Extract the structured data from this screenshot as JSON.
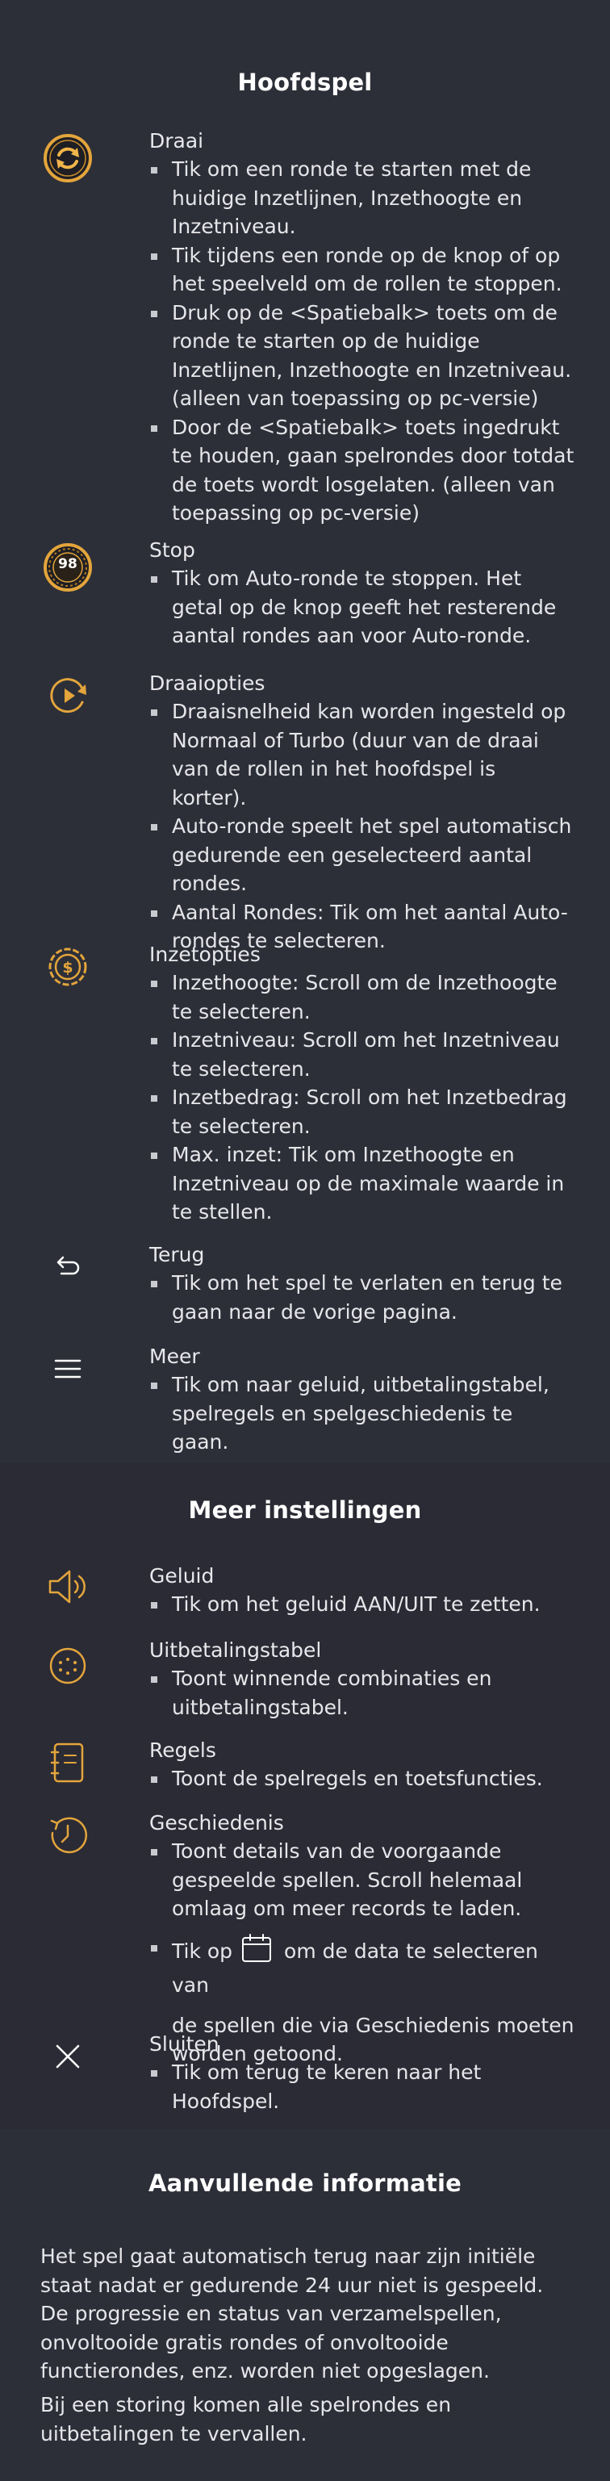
{
  "sections": {
    "main_game": {
      "title": "Hoofdspel",
      "spin": {
        "title": "Draai",
        "bullets": [
          "Tik om een ronde te starten met de huidige Inzetlijnen, Inzethoogte en Inzetniveau.",
          "Tik tijdens een ronde op de knop of op het speelveld om de rollen te stoppen.",
          "Druk op de <Spatiebalk> toets om de ronde te starten op de huidige Inzetlijnen, Inzethoogte en Inzetniveau. (alleen van toepassing op pc-versie)",
          "Door de <Spatiebalk> toets ingedrukt te houden, gaan spelrondes door totdat de toets wordt losgelaten. (alleen van toepassing op pc-versie)"
        ]
      },
      "stop": {
        "title": "Stop",
        "icon_number": "98",
        "bullets": [
          "Tik om Auto-ronde te stoppen. Het getal op de knop geeft het resterende aantal rondes aan voor Auto-ronde."
        ]
      },
      "spin_options": {
        "title": "Draaiopties",
        "bullets": [
          "Draaisnelheid kan worden ingesteld op Normaal of Turbo (duur van de draai van de rollen in het hoofdspel is korter).",
          "Auto-ronde speelt het spel automatisch gedurende een geselecteerd aantal rondes.",
          "Aantal Rondes: Tik om het aantal Auto-rondes te selecteren."
        ]
      },
      "bet_options": {
        "title": "Inzetopties",
        "bullets": [
          "Inzethoogte: Scroll om de Inzethoogte te selecteren.",
          "Inzetniveau: Scroll om het Inzetniveau te selecteren.",
          "Inzetbedrag: Scroll om het Inzetbedrag te selecteren.",
          "Max. inzet: Tik om Inzethoogte en Inzetniveau op de maximale waarde in te stellen."
        ]
      },
      "back": {
        "title": "Terug",
        "bullets": [
          "Tik om het spel te verlaten en terug te gaan naar de vorige pagina."
        ]
      },
      "more": {
        "title": "Meer",
        "bullets": [
          "Tik om naar geluid, uitbetalingstabel, spelregels en spelgeschiedenis te gaan."
        ]
      }
    },
    "more_settings": {
      "title": "Meer instellingen",
      "sound": {
        "title": "Geluid",
        "bullets": [
          "Tik om het geluid AAN/UIT te zetten."
        ]
      },
      "paytable": {
        "title": "Uitbetalingstabel",
        "bullets": [
          "Toont winnende combinaties en uitbetalingstabel."
        ]
      },
      "rules": {
        "title": "Regels",
        "bullets": [
          "Toont de spelregels en toetsfuncties."
        ]
      },
      "history": {
        "title": "Geschiedenis",
        "bullets": [
          "Toont details van de voorgaande gespeelde spellen. Scroll helemaal omlaag om meer records te laden."
        ],
        "calendar_before": "Tik op",
        "calendar_after": "om de data te selecteren van",
        "calendar_tail": "de spellen die via Geschiedenis moeten worden getoond."
      },
      "close": {
        "title": "Sluiten",
        "bullets": [
          "Tik om terug te keren naar het Hoofdspel."
        ]
      }
    },
    "additional_info": {
      "title": "Aanvullende informatie",
      "paragraphs": [
        "Het spel gaat automatisch terug naar zijn initiële staat nadat er gedurende 24 uur niet is gespeeld. De progressie en status van verzamelspellen, onvoltooide gratis rondes of onvoltooide functierondes, enz. worden niet opgeslagen.",
        "Bij een storing komen alle spelrondes en uitbetalingen te vervallen."
      ]
    }
  },
  "colors": {
    "icon_gold": "#e3a53c",
    "background_dark": "#2b2b35",
    "background_light": "#2d2f38",
    "text": "#e6e6ea"
  },
  "icons": [
    "spin-icon",
    "stop-icon",
    "spin-options-icon",
    "bet-options-icon",
    "back-icon",
    "menu-icon",
    "sound-icon",
    "paytable-icon",
    "rules-icon",
    "history-icon",
    "calendar-icon",
    "close-icon"
  ]
}
